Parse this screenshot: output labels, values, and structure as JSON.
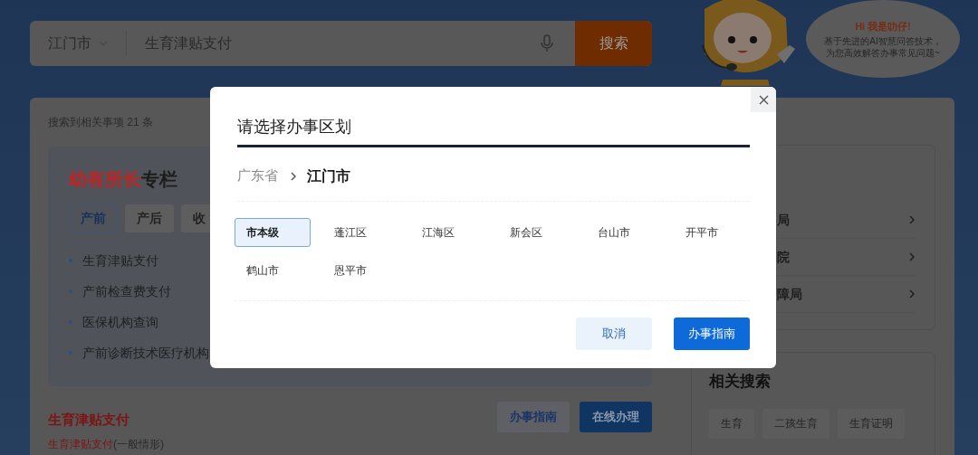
{
  "search": {
    "city": "江门市",
    "query": "生育津贴支付",
    "button": "搜索"
  },
  "assistant": {
    "greeting": "Hi 我是叻仔!",
    "lines": [
      "基于先进的AI智慧问答技术，",
      "为您高效解答办事常见问题~"
    ]
  },
  "results": {
    "count_text": "搜索到相关事项 21 条",
    "column": {
      "title_highlight": "幼有所长",
      "title_rest": "专栏",
      "tabs": [
        {
          "label": "产前",
          "selected": true
        },
        {
          "label": "产后",
          "selected": false
        },
        {
          "label": "收",
          "selected": false
        }
      ],
      "items": [
        "生育津贴支付",
        "产前检查费支付",
        "医保机构查询",
        "产前诊断技术医疗机构"
      ]
    },
    "first_result": {
      "title": "生育津贴支付",
      "link": "生育津贴支付",
      "note": "(一般情形)",
      "buttons": [
        {
          "label": "办事指南",
          "kind": "secondary"
        },
        {
          "label": "在线办理",
          "kind": "primary"
        }
      ]
    }
  },
  "side": {
    "departments": [
      "局",
      "院",
      "障局"
    ],
    "related_title": "相关搜索",
    "related_tags": [
      "生育",
      "二孩生育",
      "生育证明"
    ]
  },
  "dialog": {
    "title": "请选择办事区划",
    "breadcrumb": [
      {
        "label": "广东省",
        "current": false
      },
      {
        "label": "江门市",
        "current": true
      }
    ],
    "regions": [
      {
        "label": "市本级",
        "selected": true
      },
      {
        "label": "蓬江区",
        "selected": false
      },
      {
        "label": "江海区",
        "selected": false
      },
      {
        "label": "新会区",
        "selected": false
      },
      {
        "label": "台山市",
        "selected": false
      },
      {
        "label": "开平市",
        "selected": false
      },
      {
        "label": "鹤山市",
        "selected": false
      },
      {
        "label": "恩平市",
        "selected": false
      }
    ],
    "buttons": [
      {
        "label": "取消",
        "kind": "secondary"
      },
      {
        "label": "办事指南",
        "kind": "primary"
      }
    ]
  }
}
